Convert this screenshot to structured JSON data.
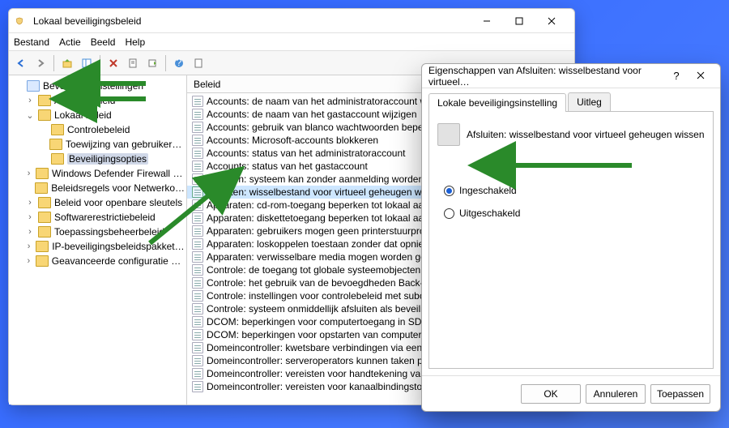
{
  "window": {
    "title": "Lokaal beveiligingsbeleid",
    "menu": [
      "Bestand",
      "Actie",
      "Beeld",
      "Help"
    ]
  },
  "tree": [
    {
      "depth": 0,
      "toggle": "",
      "label": "Beveiligingsinstellingen",
      "root": true
    },
    {
      "depth": 1,
      "toggle": ">",
      "label": "Accountbeleid"
    },
    {
      "depth": 1,
      "toggle": "v",
      "label": "Lokaal beleid"
    },
    {
      "depth": 2,
      "toggle": "",
      "label": "Controlebeleid"
    },
    {
      "depth": 2,
      "toggle": "",
      "label": "Toewijzing van gebruikersrechten"
    },
    {
      "depth": 2,
      "toggle": "",
      "label": "Beveiligingsopties",
      "selected": true
    },
    {
      "depth": 1,
      "toggle": ">",
      "label": "Windows Defender Firewall met geava…"
    },
    {
      "depth": 1,
      "toggle": "",
      "label": "Beleidsregels voor Netwerkoverzicht Mana…"
    },
    {
      "depth": 1,
      "toggle": ">",
      "label": "Beleid voor openbare sleutels"
    },
    {
      "depth": 1,
      "toggle": ">",
      "label": "Softwarerestrictiebeleid"
    },
    {
      "depth": 1,
      "toggle": ">",
      "label": "Toepassingsbeheerbeleid"
    },
    {
      "depth": 1,
      "toggle": ">",
      "label": "IP-beveiligingsbeleidspakketten op Lo…"
    },
    {
      "depth": 1,
      "toggle": ">",
      "label": "Geavanceerde configuratie van controle…"
    }
  ],
  "list_header": "Beleid",
  "list": [
    "Accounts: de naam van het administratoraccount wijzigen",
    "Accounts: de naam van het gastaccount wijzigen",
    "Accounts: gebruik van blanco wachtwoorden beperken tot aa…",
    "Accounts: Microsoft-accounts blokkeren",
    "Accounts: status van het administratoraccount",
    "Accounts: status van het gastaccount",
    "Afsluiten: systeem kan zonder aanmelding worden afgesloten",
    "Afsluiten: wisselbestand voor virtueel geheugen wissen",
    "Apparaten: cd-rom-toegang beperken tot lokaal aangemelde…",
    "Apparaten: diskettetoegang beperken tot lokaal aangemelde …",
    "Apparaten: gebruikers mogen geen printerstuurprogramma's…",
    "Apparaten: loskoppelen toestaan zonder dat opnieuw hoeft t…",
    "Apparaten: verwisselbare media mogen worden geformatteer…",
    "Controle: de toegang tot globale systeemobjecten controleren",
    "Controle: het gebruik van de bevoegdheden Back-up en Teru…",
    "Controle: instellingen voor controlebeleid met subcategorie…",
    "Controle: systeem onmiddellijk afsluiten als beveiligingscontr…",
    "DCOM: beperkingen voor computertoegang in SDDL (Securit…",
    "DCOM: beperkingen voor opstarten van computer in SDDL (S…",
    "Domeincontroller: kwetsbare verbindingen via een beveiligd …",
    "Domeincontroller: serveroperators kunnen taken plannen",
    "Domeincontroller: vereisten voor handtekening van LDAP-ser…",
    "Domeincontroller: vereisten voor kanaalbindingstoken van L…"
  ],
  "list_selected_index": 7,
  "dialog": {
    "title": "Eigenschappen van Afsluiten: wisselbestand voor virtueel…",
    "tabs": [
      "Lokale beveiligingsinstelling",
      "Uitleg"
    ],
    "policy_label": "Afsluiten: wisselbestand voor virtueel geheugen wissen",
    "radio_on": "Ingeschakeld",
    "radio_off": "Uitgeschakeld",
    "ok": "OK",
    "cancel": "Annuleren",
    "apply": "Toepassen"
  }
}
